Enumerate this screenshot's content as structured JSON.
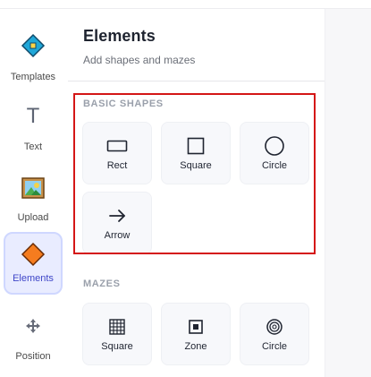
{
  "rail": {
    "items": [
      {
        "label": "Templates",
        "icon": "templates-icon"
      },
      {
        "label": "Text",
        "icon": "text-icon"
      },
      {
        "label": "Upload",
        "icon": "upload-icon"
      },
      {
        "label": "Elements",
        "icon": "elements-icon",
        "active": true
      },
      {
        "label": "Position",
        "icon": "position-icon"
      }
    ]
  },
  "panel": {
    "title": "Elements",
    "subtitle": "Add shapes and mazes"
  },
  "sections": {
    "basic": {
      "title": "BASIC SHAPES",
      "tiles": [
        {
          "label": "Rect",
          "icon": "rect-icon"
        },
        {
          "label": "Square",
          "icon": "square-icon"
        },
        {
          "label": "Circle",
          "icon": "circle-icon"
        },
        {
          "label": "Arrow",
          "icon": "arrow-icon"
        }
      ]
    },
    "mazes": {
      "title": "MAZES",
      "tiles": [
        {
          "label": "Square",
          "icon": "grid-maze-icon"
        },
        {
          "label": "Zone",
          "icon": "zone-icon"
        },
        {
          "label": "Circle",
          "icon": "circle-maze-icon"
        }
      ]
    }
  },
  "colors": {
    "accent": "#3f46c8",
    "highlight": "#d41616",
    "elements_orange": "#f57c1f"
  }
}
